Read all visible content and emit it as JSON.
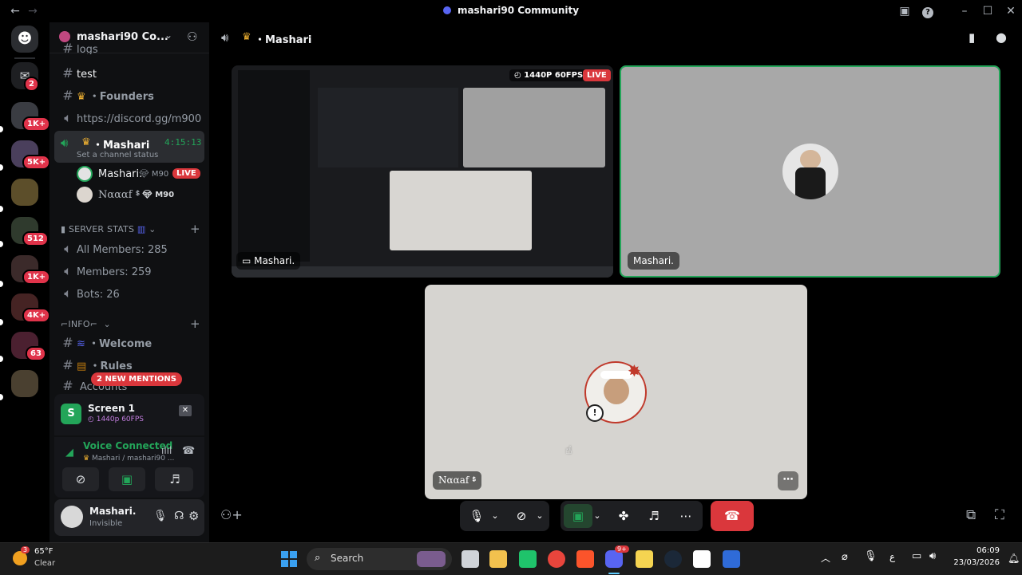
{
  "window": {
    "title": "mashari90 Community",
    "icons": [
      "back-arrow-icon",
      "forward-arrow-icon",
      "inbox-icon",
      "help-icon",
      "minimize-icon",
      "maximize-icon",
      "close-icon"
    ]
  },
  "rail": {
    "badges": [
      "2",
      "1K+",
      "5K+",
      "512",
      "1K+",
      "4K+",
      "63"
    ]
  },
  "sidebar": {
    "server_name": "mashari90 Co...",
    "channels_top": [
      {
        "label": "logs"
      },
      {
        "label": "test"
      },
      {
        "label": "・Founders"
      },
      {
        "label": "https://discord.gg/m900"
      }
    ],
    "voice_channel": {
      "label": "・Mashari",
      "timer": "4:15:13",
      "status": "Set a channel status"
    },
    "voice_members": [
      {
        "name": "Mashari.",
        "tag": "M90",
        "live": "LIVE"
      },
      {
        "name": "Nαααf ᙚ",
        "tag": "M90"
      }
    ],
    "category_stats": "SERVER STATS",
    "stats": [
      {
        "label": "All Members: 285"
      },
      {
        "label": "Members: 259"
      },
      {
        "label": "Bots: 26"
      }
    ],
    "category_info": "INFO",
    "info_channels": [
      {
        "label": "・Welcome"
      },
      {
        "label": "・Rules"
      },
      {
        "label": "Accounts"
      }
    ],
    "mentions_badge": "2 NEW MENTIONS"
  },
  "screen_panel": {
    "title": "Screen 1",
    "quality": "1440p 60FPS"
  },
  "voice_panel": {
    "status": "Voice Connected",
    "location": "Mashari / mashari90 ..."
  },
  "user_panel": {
    "name": "Mashari.",
    "status": "Invisible"
  },
  "main": {
    "channel_title": "・Mashari",
    "stream_quality": "1440P 60FPS",
    "live_label": "LIVE",
    "tiles": [
      {
        "name": "Mashari."
      },
      {
        "name": "Mashari."
      },
      {
        "name": "Nααaf ᙚ"
      }
    ]
  },
  "taskbar": {
    "weather_temp": "65°F",
    "weather_desc": "Clear",
    "weather_badge": "3",
    "search_label": "Search",
    "lang": "ع",
    "time": "06:09",
    "date": "23/03/2026",
    "discord_badge": "9+"
  },
  "colors": {
    "accent_green": "#23a559",
    "live_red": "#da373c",
    "hangup_red": "#da373c",
    "bg": "#000000"
  }
}
